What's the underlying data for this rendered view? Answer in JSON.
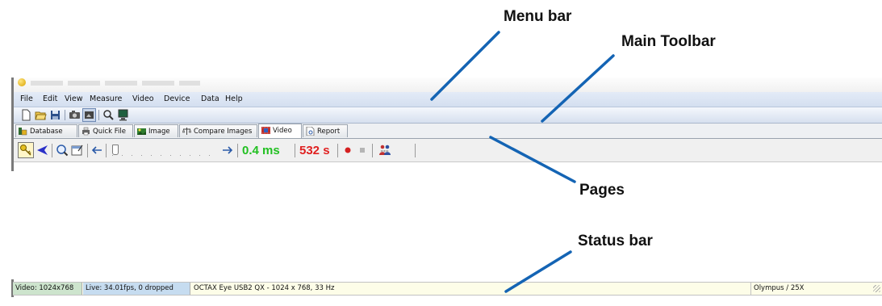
{
  "callouts": {
    "menu_bar": "Menu bar",
    "main_toolbar": "Main Toolbar",
    "pages": "Pages",
    "status_bar": "Status bar"
  },
  "menu": {
    "items": [
      "File",
      "Edit",
      "View",
      "Measure",
      "Video",
      "Device",
      "Data",
      "Help"
    ]
  },
  "main_toolbar": {
    "icons": [
      "new-icon",
      "open-folder-icon",
      "save-icon",
      "camera-icon",
      "live-view-icon",
      "zoom-icon",
      "monitor-icon"
    ]
  },
  "tabs": [
    {
      "label": "Database",
      "icon": "database-icon"
    },
    {
      "label": "Quick File",
      "icon": "printer-icon"
    },
    {
      "label": "Image",
      "icon": "image-icon"
    },
    {
      "label": "Compare Images",
      "icon": "compare-icon"
    },
    {
      "label": "Video",
      "icon": "video-icon",
      "active": true
    },
    {
      "label": "Report",
      "icon": "report-icon"
    }
  ],
  "video_toolbar": {
    "exposure": "0.4 ms",
    "duration": "532 s",
    "exposure_color": "#22c022",
    "duration_color": "#e02020",
    "icons": [
      "key-icon",
      "back-arrow-icon",
      "zoom-settings-icon",
      "properties-icon",
      "step-back-icon",
      "slider",
      "step-forward-icon",
      "record-icon",
      "stop-icon",
      "people-icon"
    ]
  },
  "status_bar": {
    "video": "Video: 1024x768",
    "live": "Live: 34.01fps, 0 dropped",
    "camera": "OCTAX Eye USB2 QX - 1024 x 768, 33 Hz",
    "objective": "Olympus / 25X"
  },
  "colors": {
    "accent_line": "#1464b4",
    "status_video_bg": "#cde4cd",
    "status_live_bg": "#c6dcf0"
  }
}
